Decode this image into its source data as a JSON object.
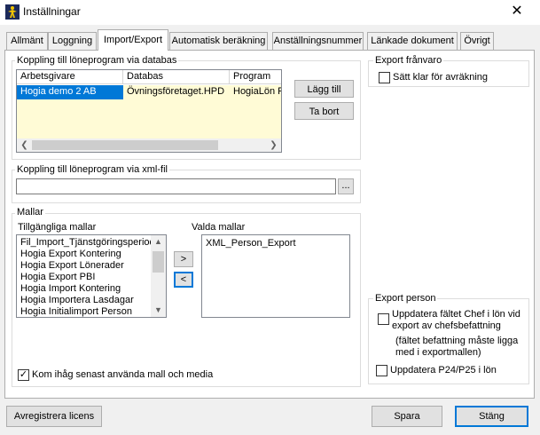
{
  "window": {
    "title": "Inställningar",
    "close_glyph": "✕"
  },
  "tabs": [
    {
      "label": "Allmänt"
    },
    {
      "label": "Loggning"
    },
    {
      "label": "Import/Export"
    },
    {
      "label": "Automatisk beräkning"
    },
    {
      "label": "Anställningsnummer"
    },
    {
      "label": "Länkade dokument"
    },
    {
      "label": "Övrigt"
    }
  ],
  "db_group": {
    "label": "Koppling till löneprogram via databas",
    "columns": [
      "Arbetsgivare",
      "Databas",
      "Program"
    ],
    "rows": [
      [
        "Hogia demo 2 AB",
        "Övningsföretaget.HPD",
        "HogiaLön P"
      ]
    ],
    "add_button": "Lägg till",
    "remove_button": "Ta bort"
  },
  "xml_group": {
    "label": "Koppling till löneprogram via xml-fil",
    "path_value": "",
    "browse_button": "..."
  },
  "templates_group": {
    "label": "Mallar",
    "available_label": "Tillgängliga mallar",
    "available_items": [
      "Fil_Import_Tjänstgöringsperiode",
      "Hogia Export Kontering",
      "Hogia Export Lönerader",
      "Hogia Export PBI",
      "Hogia Import Kontering",
      "Hogia Importera Lasdagar",
      "Hogia Initialimport Person"
    ],
    "selected_label": "Valda mallar",
    "selected_items": [
      "XML_Person_Export"
    ],
    "move_right": ">",
    "move_left": "<",
    "remember_label": "Kom ihåg senast använda mall och media",
    "remember_checked": true
  },
  "export_absence": {
    "label": "Export frånvaro",
    "ready_label": "Sätt klar för avräkning",
    "ready_checked": false
  },
  "export_person": {
    "label": "Export person",
    "update_chief_line1": "Uppdatera fältet Chef i lön vid",
    "update_chief_line2": "export av chefsbefattning",
    "note_line1": "(fältet befattning måste ligga",
    "note_line2": "med i exportmallen)",
    "update_chief_checked": false,
    "update_p24_label": "Uppdatera P24/P25 i lön",
    "update_p24_checked": false
  },
  "footer": {
    "unregister_button": "Avregistrera licens",
    "save_button": "Spara",
    "close_button": "Stäng"
  },
  "icons": {
    "app": "hogia-person-icon",
    "check": "✓"
  },
  "colors": {
    "selection": "#0078d7",
    "row_bg": "#fffbd6",
    "accent": "#0078d7"
  }
}
